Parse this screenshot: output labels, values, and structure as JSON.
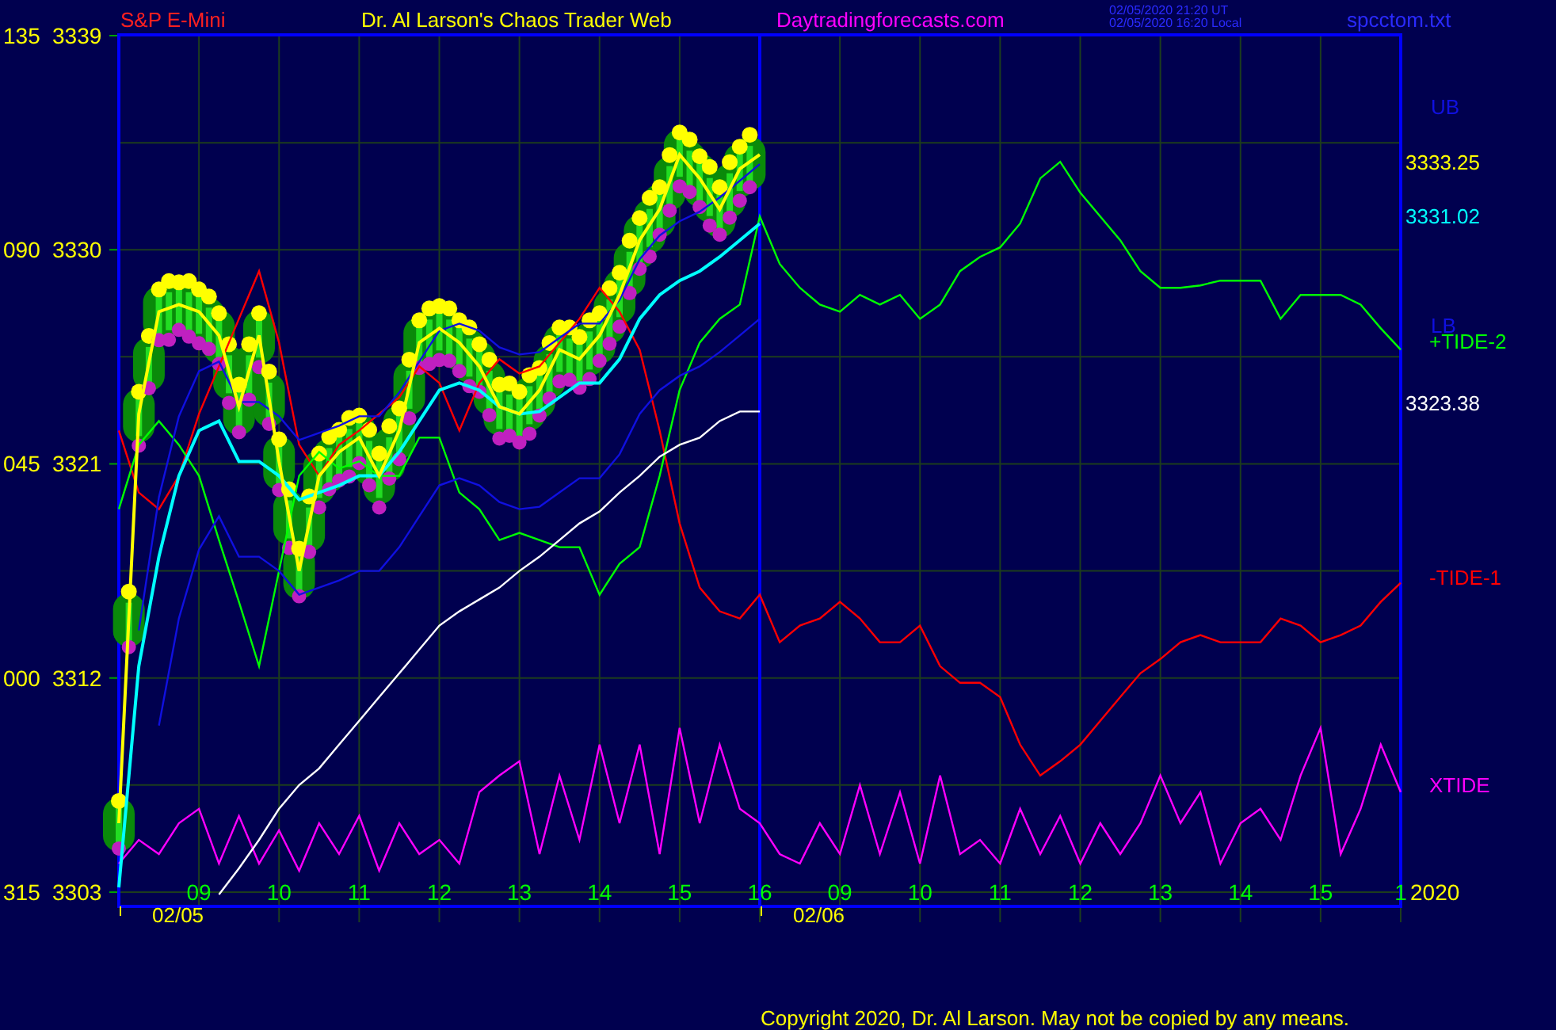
{
  "header": {
    "instrument": "S&P E-Mini",
    "title": "Dr. Al Larson's Chaos Trader Web",
    "site": "Daytradingforecasts.com",
    "timestamps": [
      "02/05/2020 21:20 UT",
      "02/05/2020 16:20 Local"
    ],
    "file": "spcctom.txt"
  },
  "chart": {
    "angle_labels": [
      "135",
      "090",
      "045",
      "000",
      "315"
    ],
    "date_labels": [
      "02/05",
      "02/06"
    ],
    "second_day_hour_labels": [
      "09",
      "10",
      "11",
      "12",
      "13",
      "14",
      "15",
      "1"
    ],
    "year": "2020",
    "legend": [
      {
        "text": "UB",
        "color": "#1010e0"
      },
      {
        "text": "3333.25",
        "color": "#ffff00"
      },
      {
        "text": "3331.02",
        "color": "#00ffff"
      },
      {
        "text": "LB",
        "color": "#1010e0"
      },
      {
        "text": "+TIDE-2",
        "color": "#00ff00"
      },
      {
        "text": "3323.38",
        "color": "#ffffff"
      },
      {
        "text": "-TIDE-1",
        "color": "#ff0000"
      },
      {
        "text": "XTIDE",
        "color": "#ff00ff"
      }
    ],
    "chart_data": {
      "type": "line",
      "grid": true,
      "xlim": [
        8,
        24
      ],
      "ylim": [
        3302.4,
        3339.1
      ],
      "yticks": [
        3339,
        3330,
        3321,
        3312,
        3303
      ],
      "xticks": [
        {
          "value": 9,
          "label": "09"
        },
        {
          "value": 10,
          "label": "10"
        },
        {
          "value": 11,
          "label": "11"
        },
        {
          "value": 12,
          "label": "12"
        },
        {
          "value": 13,
          "label": "13"
        },
        {
          "value": 14,
          "label": "14"
        },
        {
          "value": 15,
          "label": "15"
        },
        {
          "value": 16,
          "label": "16"
        }
      ],
      "x": [
        8,
        8.25,
        8.5,
        8.75,
        9,
        9.25,
        9.5,
        9.75,
        10,
        10.25,
        10.5,
        10.75,
        11,
        11.25,
        11.5,
        11.75,
        12,
        12.25,
        12.5,
        12.75,
        13,
        13.25,
        13.5,
        13.75,
        14,
        14.25,
        14.5,
        14.75,
        15,
        15.25,
        15.5,
        15.75,
        16,
        16.25,
        16.5,
        16.75,
        17,
        17.25,
        17.5,
        17.75,
        18,
        18.25,
        18.5,
        18.75,
        19,
        19.25,
        19.5,
        19.75,
        20,
        20.25,
        20.5,
        20.75,
        21,
        21.25,
        21.5,
        21.75,
        22,
        22.25,
        22.5,
        22.75,
        23,
        23.25,
        23.5,
        23.75,
        24
      ],
      "series": [
        {
          "color": "#ffff00",
          "values": [
            3305.9,
            3323.1,
            3327.4,
            3327.7,
            3327.4,
            3326.4,
            3323.4,
            3326.4,
            3321.1,
            3316.5,
            3320.5,
            3321.5,
            3322.1,
            3320.5,
            3322.4,
            3326.1,
            3326.7,
            3326.1,
            3325.1,
            3323.4,
            3323.1,
            3324.1,
            3325.8,
            3325.4,
            3326.4,
            3328.1,
            3330.4,
            3331.7,
            3334.0,
            3333.0,
            3331.7,
            3333.4,
            3334.0,
            null,
            null,
            null,
            null,
            null,
            null,
            null,
            null,
            null,
            null,
            null,
            null,
            null,
            null,
            null,
            null,
            null,
            null,
            null,
            null,
            null,
            null,
            null,
            null,
            null,
            null,
            null,
            null,
            null,
            null,
            null,
            null
          ]
        },
        {
          "color": "#00ffff",
          "values": [
            3303.2,
            3312.5,
            3317.1,
            3320.5,
            3322.4,
            3322.8,
            3321.1,
            3321.1,
            3320.5,
            3319.5,
            3319.8,
            3320.1,
            3320.5,
            3320.5,
            3321.5,
            3322.8,
            3324.1,
            3324.4,
            3324.1,
            3323.4,
            3323.1,
            3323.2,
            3323.8,
            3324.4,
            3324.4,
            3325.4,
            3327.1,
            3328.1,
            3328.7,
            3329.1,
            3329.7,
            3330.4,
            3331.1,
            null,
            null,
            null,
            null,
            null,
            null,
            null,
            null,
            null,
            null,
            null,
            null,
            null,
            null,
            null,
            null,
            null,
            null,
            null,
            null,
            null,
            null,
            null,
            null,
            null,
            null,
            null,
            null,
            null,
            null,
            null,
            null
          ]
        },
        {
          "color": "#ffffff",
          "values": [
            null,
            null,
            null,
            null,
            null,
            3302.9,
            3304.0,
            3305.2,
            3306.5,
            3307.5,
            3308.2,
            3309.2,
            3310.2,
            3311.2,
            3312.2,
            3313.2,
            3314.2,
            3314.8,
            3315.3,
            3315.8,
            3316.5,
            3317.1,
            3317.8,
            3318.5,
            3319.0,
            3319.8,
            3320.5,
            3321.3,
            3321.8,
            3322.1,
            3322.8,
            3323.2,
            3323.2,
            null,
            null,
            null,
            null,
            null,
            null,
            null,
            null,
            null,
            null,
            null,
            null,
            null,
            null,
            null,
            null,
            null,
            null,
            null,
            null,
            null,
            null,
            null,
            null,
            null,
            null,
            null,
            null,
            null,
            null,
            null,
            null
          ]
        },
        {
          "color": "#1010e0",
          "values": [
            null,
            3314.0,
            3319.6,
            3323.0,
            3324.9,
            3325.3,
            3323.6,
            3323.6,
            3323.0,
            3322.0,
            3322.3,
            3322.6,
            3323.0,
            3323.0,
            3324.0,
            3325.3,
            3326.6,
            3326.9,
            3326.6,
            3325.9,
            3325.6,
            3325.7,
            3326.3,
            3326.9,
            3326.9,
            3327.9,
            3329.6,
            3330.6,
            3331.2,
            3331.6,
            3332.2,
            3332.9,
            3333.6,
            null,
            null,
            null,
            null,
            null,
            null,
            null,
            null,
            null,
            null,
            null,
            null,
            null,
            null,
            null,
            null,
            null,
            null,
            null,
            null,
            null,
            null,
            null,
            null,
            null,
            null,
            null,
            null,
            null,
            null,
            null,
            null
          ]
        },
        {
          "color": "#1010e0",
          "values": [
            null,
            null,
            3310.0,
            3314.5,
            3317.4,
            3318.8,
            3317.1,
            3317.1,
            3316.5,
            3315.5,
            3315.8,
            3316.1,
            3316.5,
            3316.5,
            3317.5,
            3318.8,
            3320.1,
            3320.4,
            3320.1,
            3319.4,
            3319.1,
            3319.2,
            3319.8,
            3320.4,
            3320.4,
            3321.4,
            3323.1,
            3324.1,
            3324.7,
            3325.1,
            3325.7,
            3326.4,
            3327.1,
            null,
            null,
            null,
            null,
            null,
            null,
            null,
            null,
            null,
            null,
            null,
            null,
            null,
            null,
            null,
            null,
            null,
            null,
            null,
            null,
            null,
            null,
            null,
            null,
            null,
            null,
            null,
            null,
            null,
            null,
            null,
            null
          ]
        },
        {
          "color": "#00ff00",
          "values": [
            3319.1,
            3321.8,
            3322.8,
            3321.8,
            3320.5,
            3317.8,
            3315.2,
            3312.5,
            3316.5,
            3320.5,
            3321.5,
            3320.8,
            3321.1,
            3320.5,
            3320.5,
            3322.1,
            3322.1,
            3319.8,
            3319.1,
            3317.8,
            3318.1,
            3317.8,
            3317.5,
            3317.5,
            3315.5,
            3316.8,
            3317.5,
            3320.5,
            3324.1,
            3326.1,
            3327.1,
            3327.7,
            3331.4,
            3329.4,
            3328.4,
            3327.7,
            3327.4,
            3328.1,
            3327.7,
            3328.1,
            3327.1,
            3327.7,
            3329.1,
            3329.7,
            3330.1,
            3331.1,
            3333.0,
            3333.7,
            3332.4,
            3331.4,
            3330.4,
            3329.1,
            3328.4,
            3328.4,
            3328.5,
            3328.7,
            3328.7,
            3328.7,
            3327.1,
            3328.1,
            3328.1,
            3328.1,
            3327.7,
            3326.7,
            3325.8
          ]
        },
        {
          "color": "#ff0000",
          "values": [
            3322.4,
            3319.8,
            3319.1,
            3320.5,
            3323.1,
            3325.1,
            3327.1,
            3329.1,
            3326.1,
            3321.8,
            3320.5,
            3321.8,
            3322.4,
            3323.1,
            3323.8,
            3325.1,
            3324.4,
            3322.4,
            3324.4,
            3325.4,
            3324.8,
            3325.1,
            3326.1,
            3327.1,
            3328.4,
            3327.4,
            3325.8,
            3322.4,
            3318.5,
            3315.8,
            3314.8,
            3314.5,
            3315.5,
            3313.5,
            3314.2,
            3314.5,
            3315.2,
            3314.5,
            3313.5,
            3313.5,
            3314.2,
            3312.5,
            3311.8,
            3311.8,
            3311.2,
            3309.2,
            3307.9,
            3308.5,
            3309.2,
            3310.2,
            3311.2,
            3312.2,
            3312.8,
            3313.5,
            3313.8,
            3313.5,
            3313.5,
            3313.5,
            3314.5,
            3314.2,
            3313.5,
            3313.8,
            3314.2,
            3315.2,
            3316.0
          ]
        },
        {
          "color": "#ff00ff",
          "values": [
            3304.2,
            3305.2,
            3304.6,
            3305.9,
            3306.5,
            3304.2,
            3306.2,
            3304.2,
            3305.6,
            3303.9,
            3305.9,
            3304.6,
            3306.2,
            3303.9,
            3305.9,
            3304.6,
            3305.2,
            3304.2,
            3307.2,
            3307.9,
            3308.5,
            3304.6,
            3307.9,
            3305.2,
            3309.2,
            3305.9,
            3309.2,
            3304.6,
            3309.9,
            3305.9,
            3309.2,
            3306.5,
            3305.9,
            3304.6,
            3304.2,
            3305.9,
            3304.6,
            3307.5,
            3304.6,
            3307.2,
            3304.2,
            3307.9,
            3304.6,
            3305.2,
            3304.2,
            3306.5,
            3304.6,
            3306.2,
            3304.2,
            3305.9,
            3304.6,
            3305.9,
            3307.9,
            3305.9,
            3307.2,
            3304.2,
            3305.9,
            3306.5,
            3305.2,
            3307.9,
            3309.9,
            3304.6,
            3306.5,
            3309.2,
            3307.2
          ]
        }
      ]
    }
  },
  "copyright": "Copyright 2020, Dr. Al Larson. May not be copied by any means."
}
